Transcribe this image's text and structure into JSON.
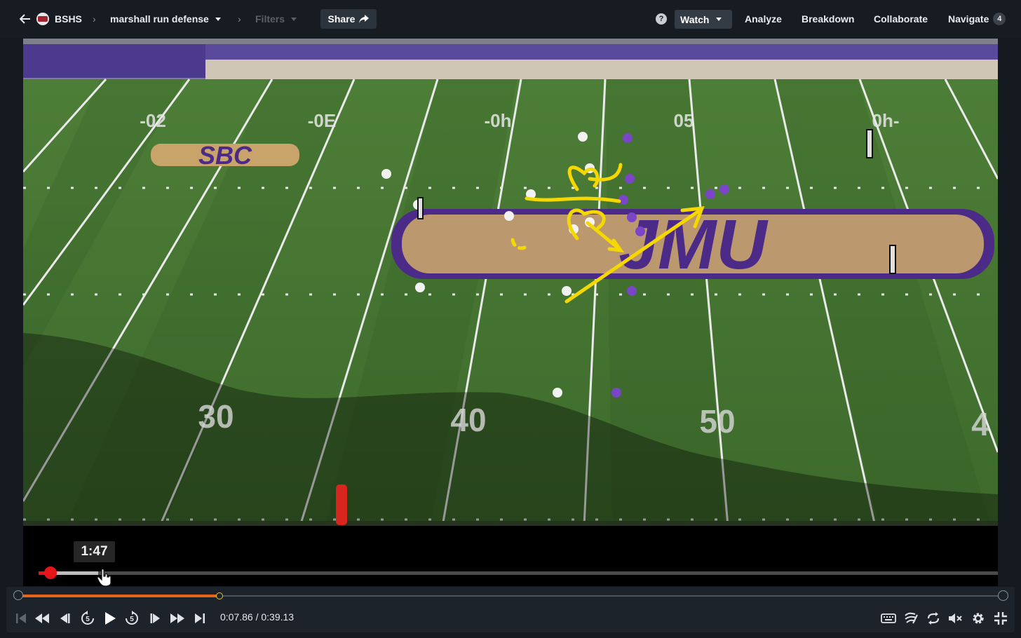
{
  "header": {
    "team": "BSHS",
    "playlist": "marshall run defense",
    "filters_label": "Filters",
    "share_label": "Share",
    "help_label": "?",
    "watch_label": "Watch",
    "nav": [
      "Analyze",
      "Breakdown",
      "Collaborate",
      "Navigate"
    ],
    "navigate_badge": "4"
  },
  "video": {
    "field_numbers_far": [
      "-02",
      "-0E",
      "-0h",
      "05",
      "0h-"
    ],
    "field_numbers_near": [
      "30",
      "40",
      "50",
      "4"
    ],
    "conference_logo": "SBC",
    "endzone_logo": "JMU",
    "embedded_timestamp": "1:47",
    "embedded_progress_fraction": 0.06,
    "annotation_color": "#f5d800"
  },
  "player": {
    "time_display": "0:07.86 / 0:39.13",
    "progress_fraction": 0.2,
    "accent_color": "#e8641b",
    "controls": [
      "skip-to-start",
      "rewind",
      "step-back",
      "back-5s",
      "play",
      "forward-5s",
      "step-forward",
      "fast-forward",
      "skip-to-end"
    ],
    "right_controls": [
      "keyboard",
      "telestrate",
      "loop",
      "mute",
      "settings",
      "exit-fullscreen"
    ]
  }
}
